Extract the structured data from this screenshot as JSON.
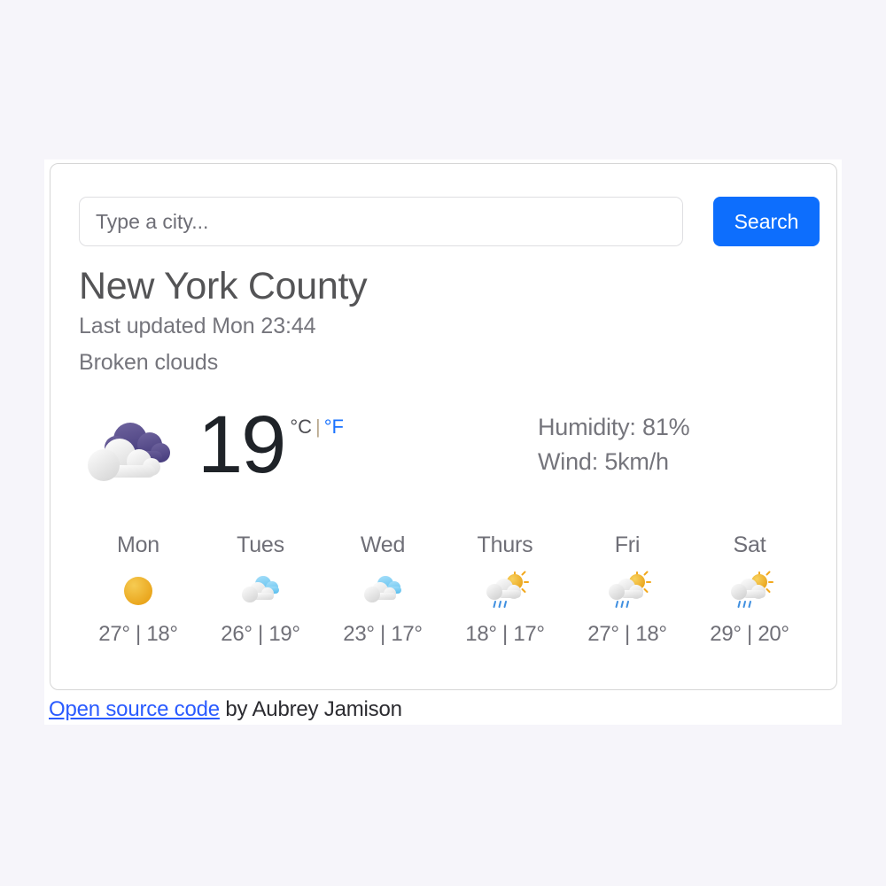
{
  "search": {
    "placeholder": "Type a city...",
    "value": "",
    "button_label": "Search"
  },
  "current": {
    "city": "New York County",
    "last_updated": "Last updated Mon 23:44",
    "condition": "Broken clouds",
    "icon": "broken-clouds-icon",
    "temperature": "19",
    "unit_celsius": "°C",
    "unit_separator": "|",
    "unit_fahrenheit": "°F",
    "active_unit": "celsius",
    "humidity": "Humidity: 81%",
    "wind": "Wind: 5km/h"
  },
  "forecast": [
    {
      "day": "Mon",
      "icon": "sun-icon",
      "temps": "27° | 18°"
    },
    {
      "day": "Tues",
      "icon": "cloud-icon",
      "temps": "26° | 19°"
    },
    {
      "day": "Wed",
      "icon": "cloud-icon",
      "temps": "23° | 17°"
    },
    {
      "day": "Thurs",
      "icon": "sun-rain-cloud-icon",
      "temps": "18° | 17°"
    },
    {
      "day": "Fri",
      "icon": "sun-rain-cloud-icon",
      "temps": "27° | 18°"
    },
    {
      "day": "Sat",
      "icon": "sun-rain-cloud-icon",
      "temps": "29° | 20°"
    }
  ],
  "footer": {
    "link_text": "Open source code",
    "attribution": " by Aubrey Jamison"
  },
  "colors": {
    "accent": "#0d6efd",
    "link": "#2a5bff",
    "page_background": "#f6f5fa",
    "card_background": "#ffffff",
    "cloud_purple": "#544a8f",
    "cloud_blue": "#7ecef4",
    "sun_yellow": "#e8a317"
  }
}
